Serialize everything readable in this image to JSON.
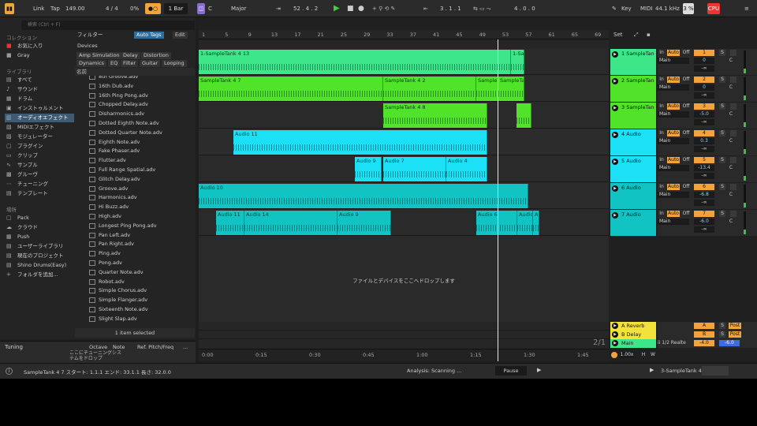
{
  "topbar": {
    "link": "Link",
    "tap": "Tap",
    "tempo": "149.00",
    "signature": "4 / 4",
    "metro_pct": "0%",
    "quant_value": "1 Bar",
    "key_root": "C",
    "scale": "Major",
    "position": "52 .  4 .  2",
    "loop_start": "3 .  1 .  1",
    "loop_length": "4 .  0 .  0",
    "key_btn": "Key",
    "midi_btn": "MIDI",
    "sample_rate": "44.1 kHz",
    "cpu_pct": "3 %",
    "cpu_label": "CPU"
  },
  "browser": {
    "search_placeholder": "検索 (Ctrl + F)",
    "collections_header": "コレクション",
    "collections": [
      "お気に入り",
      "Gray"
    ],
    "library_header": "ライブラリ",
    "library_items": [
      {
        "label": "すべて",
        "icon": "▤"
      },
      {
        "label": "サウンド",
        "icon": "♪"
      },
      {
        "label": "ドラム",
        "icon": "▦"
      },
      {
        "label": "インストゥルメント",
        "icon": "▣"
      },
      {
        "label": "オーディオエフェクト",
        "icon": "▥"
      },
      {
        "label": "MIDIエフェクト",
        "icon": "▧"
      },
      {
        "label": "モジュレーター",
        "icon": "▨"
      },
      {
        "label": "プラグイン",
        "icon": "▢"
      },
      {
        "label": "クリップ",
        "icon": "▭"
      },
      {
        "label": "サンプル",
        "icon": "∿"
      },
      {
        "label": "グルーヴ",
        "icon": "▩"
      },
      {
        "label": "チューニング",
        "icon": "⋯"
      },
      {
        "label": "テンプレート",
        "icon": "▤"
      }
    ],
    "places_header": "場所",
    "places": [
      {
        "label": "Pack",
        "icon": "▢"
      },
      {
        "label": "クラウド",
        "icon": "☁"
      },
      {
        "label": "Push",
        "icon": "▦"
      },
      {
        "label": "ユーザーライブラリ",
        "icon": "▤"
      },
      {
        "label": "現在のプロジェクト",
        "icon": "▤"
      },
      {
        "label": "Shino Drums(Easy)",
        "icon": "▤"
      },
      {
        "label": "フォルダを追加...",
        "icon": "+"
      }
    ],
    "filter_label": "フィルター",
    "auto_tags": "Auto Tags",
    "edit": "Edit",
    "devices_label": "Devices",
    "filter_tags": [
      "Amp Simulation",
      "Delay",
      "Distortion",
      "Dynamics",
      "EQ",
      "Filter",
      "Guitar",
      "Looping"
    ],
    "column_name": "名前",
    "files": [
      "8th Groove.adv",
      "16th Dub.adv",
      "16th Ping Pong.adv",
      "Chopped Delay.adv",
      "Disharmonics.adv",
      "Dotted Eighth Note.adv",
      "Dotted Quarter Note.adv",
      "Eighth Note.adv",
      "Fake Phaser.adv",
      "Flutter.adv",
      "Full Range Spatial.adv",
      "Glitch Delay.adv",
      "Groove.adv",
      "Harmonics.adv",
      "Hi Buzz.adv",
      "High.adv",
      "Longest Ping Pong.adv",
      "Pan Left.adv",
      "Pan Right.adv",
      "Ping.adv",
      "Pong.adv",
      "Quarter Note.adv",
      "Robot.adv",
      "Simple Chorus.adv",
      "Simple Flanger.adv",
      "Sixteenth Note.adv",
      "Slight Slap.adv"
    ],
    "items_selected": "1 item selected"
  },
  "tuning": {
    "title": "Tuning",
    "cols": [
      "Octave",
      "Note",
      "Ref. Pitch/Freq",
      "..."
    ],
    "drop_hint": "ここにチューニングシステムをドロップ"
  },
  "status": {
    "clip_info": "SampleTank 4 7  スタート: 1.1.1  エンド: 33.1.1  長さ: 32.0.0",
    "analysis": "Analysis: Scanning ...",
    "pause": "Pause",
    "selected_track": "3-SampleTank 4"
  },
  "arrangement": {
    "ruler_marks": [
      "1",
      "5",
      "9",
      "13",
      "17",
      "21",
      "25",
      "29",
      "33",
      "37",
      "41",
      "45",
      "49",
      "53",
      "57",
      "61",
      "65",
      "69"
    ],
    "time_marks": [
      "0:00",
      "0:15",
      "0:30",
      "0:45",
      "1:00",
      "1:15",
      "1:30",
      "1:45"
    ],
    "page_indicator": "2/1",
    "drop_message": "ファイルとデバイスをここへドロップします",
    "set_label": "Set",
    "lanes": [
      {
        "color": "#3ee68a",
        "clips": [
          {
            "name": "1-SampleTank 4 13",
            "start": 0,
            "end": 396
          },
          {
            "name": "1-Sam",
            "start": 396,
            "end": 413
          }
        ]
      },
      {
        "color": "#50e32a",
        "clips": [
          {
            "name": "SampleTank 4 7",
            "start": 0,
            "end": 234
          },
          {
            "name": "SampleTank 4 2",
            "start": 234,
            "end": 352
          },
          {
            "name": "SampleTa",
            "start": 352,
            "end": 380
          },
          {
            "name": "SampleTa",
            "start": 380,
            "end": 413
          }
        ]
      },
      {
        "color": "#50e32a",
        "clips": [
          {
            "name": "SampleTank 4 8",
            "start": 234,
            "end": 366
          },
          {
            "name": "",
            "start": 403,
            "end": 422
          }
        ]
      },
      {
        "color": "#1ce0f5",
        "clips": [
          {
            "name": "Audio 11",
            "start": 44,
            "end": 366
          }
        ]
      },
      {
        "color": "#1ce0f5",
        "clips": [
          {
            "name": "Audio 9",
            "start": 198,
            "end": 232
          },
          {
            "name": "Audio 7",
            "start": 234,
            "end": 314
          },
          {
            "name": "Audio 4",
            "start": 314,
            "end": 366
          }
        ]
      },
      {
        "color": "#12c3c3",
        "clips": [
          {
            "name": "Audio 10",
            "start": 0,
            "end": 418
          }
        ]
      },
      {
        "color": "#12c3c3",
        "clips": [
          {
            "name": "Audio 11",
            "start": 22,
            "end": 58
          },
          {
            "name": "Audio 14",
            "start": 58,
            "end": 176
          },
          {
            "name": "Audio 9",
            "start": 176,
            "end": 244
          },
          {
            "name": "Audio 6",
            "start": 352,
            "end": 404
          },
          {
            "name": "Audio",
            "start": 404,
            "end": 424
          },
          {
            "name": "Au",
            "start": 424,
            "end": 432
          }
        ]
      }
    ]
  },
  "tracks": [
    {
      "name": "1 SampleTan",
      "num": "1",
      "color": "#3ee68a",
      "vol": "0",
      "pan": "C",
      "input": "Main"
    },
    {
      "name": "2 SampleTan",
      "num": "2",
      "color": "#50e32a",
      "vol": "0",
      "pan": "C",
      "input": "Main"
    },
    {
      "name": "3 SampleTan",
      "num": "3",
      "color": "#50e32a",
      "vol": "-5.0",
      "pan": "C",
      "input": "Main"
    },
    {
      "name": "4 Audio",
      "num": "4",
      "color": "#1ce0f5",
      "vol": "0.3",
      "pan": "C",
      "input": "Main"
    },
    {
      "name": "5 Audio",
      "num": "5",
      "color": "#1ce0f5",
      "vol": "-13.4",
      "pan": "C",
      "input": "Main"
    },
    {
      "name": "6 Audio",
      "num": "6",
      "color": "#12c3c3",
      "vol": "-6.8",
      "pan": "C",
      "input": "Main"
    },
    {
      "name": "7 Audio",
      "num": "7",
      "color": "#12c3c3",
      "vol": "-6.0",
      "pan": "C",
      "input": "Main"
    }
  ],
  "track_controls": {
    "in": "In",
    "auto": "Auto",
    "off": "Off",
    "s": "S",
    "inf": "-∞"
  },
  "returns": [
    {
      "name": "A Reverb",
      "letter": "A",
      "post": "Post"
    },
    {
      "name": "B Delay",
      "letter": "B",
      "post": "Post"
    }
  ],
  "main": {
    "name": "Main",
    "setting": "ii 1/2 Realte",
    "vol": "-4.0",
    "vol2": "-6.0",
    "zoom": "1.00x",
    "h": "H",
    "w": "W"
  }
}
